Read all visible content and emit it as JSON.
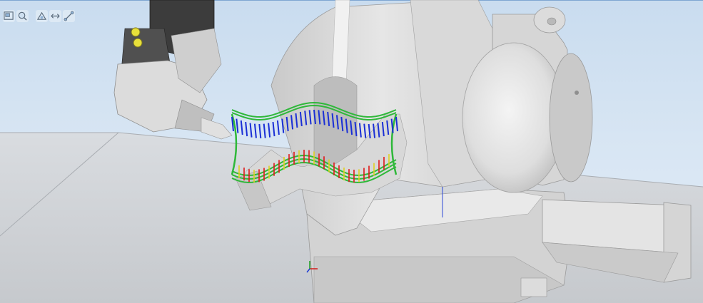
{
  "view_toolbar": {
    "buttons": [
      {
        "icon": "zoom-window-icon"
      },
      {
        "icon": "zoom-to-selection-icon"
      },
      {
        "icon": "view-angle-icon"
      },
      {
        "icon": "pan-view-icon"
      },
      {
        "icon": "measure-icon"
      }
    ]
  },
  "scene": {
    "workpiece_colors": {
      "outer_path": "#2fb83a",
      "top_targets": "#1a2fd6",
      "bottom_targets": "#e01818",
      "mid_targets": "#e0d020"
    },
    "background_color": "#d4e3f2",
    "floor_color": "#cfd2d6"
  }
}
